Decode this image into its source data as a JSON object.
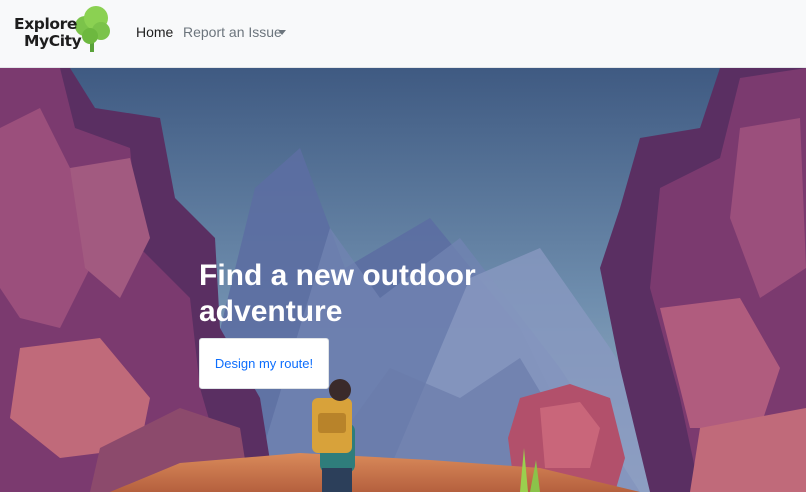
{
  "brand": {
    "line1": "Explore",
    "line2": "MyCity",
    "icon": "tree-icon",
    "tree_color": "#7bc34a"
  },
  "nav": {
    "home_label": "Home",
    "report_label": "Report an Issue",
    "report_icon": "chevron-down-icon"
  },
  "hero": {
    "headline": "Find a new outdoor adventure",
    "button_label": "Design my route!"
  },
  "colors": {
    "link": "#0d6efd",
    "nav_bg": "#f8f9fa",
    "text_muted": "#6c757d"
  }
}
